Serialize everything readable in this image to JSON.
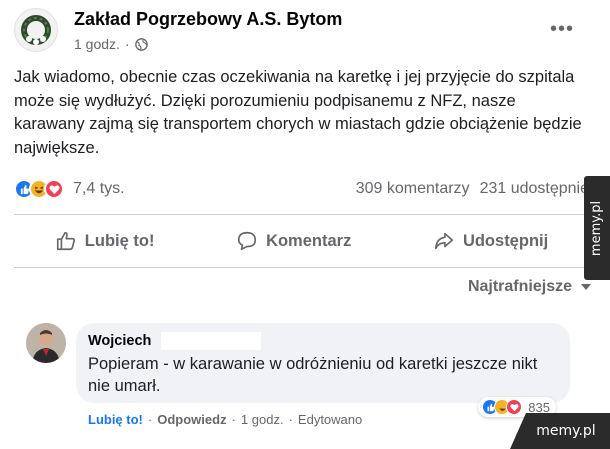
{
  "post": {
    "page_name": "Zakład Pogrzebowy A.S. Bytom",
    "time": "1 godz.",
    "dot": "·",
    "audience_icon": "globe-icon",
    "text": "Jak wiadomo, obecnie czas oczekiwania na karetkę i jej przyjęcie do szpitala może się wydłużyć. Dzięki porozumieniu podpisanemu z NFZ, nasze karawany zajmą się transportem chorych w miastach gdzie obciążenie będzie największe."
  },
  "reactions": {
    "icons": [
      "like-reaction-icon",
      "haha-reaction-icon",
      "love-reaction-icon"
    ],
    "count": "7,4 tys.",
    "comments": "309 komentarzy",
    "shares": "231 udostępnie"
  },
  "actions": {
    "like": "Lubię to!",
    "comment": "Komentarz",
    "share": "Udostępnij"
  },
  "sort": {
    "label": "Najtrafniejsze"
  },
  "comment": {
    "author": "Wojciech",
    "text": "Popieram - w karawanie w odróżnieniu od karetki jeszcze nikt nie umarł.",
    "like": "Lubię to!",
    "reply": "Odpowiedz",
    "time": "1 godz.",
    "edited": "Edytowano",
    "sep": "·",
    "reaction_count": "835"
  },
  "watermark": {
    "side": "memy.pl",
    "bottom": "memy.pl"
  },
  "colors": {
    "like_blue": "#1877f2",
    "love_red": "#f33e58",
    "haha_yellow": "#f7b125",
    "meta_gray": "#65676b"
  }
}
